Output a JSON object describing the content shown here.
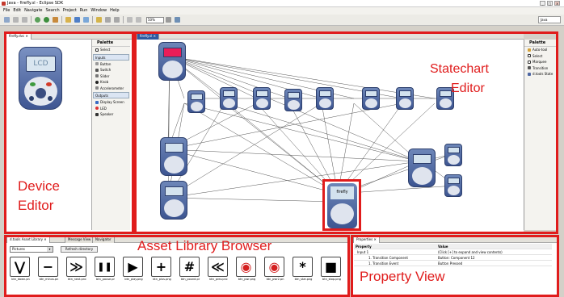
{
  "window": {
    "title": "Java - firefly.sl - Eclipse SDK",
    "minimize": "_",
    "maximize": "□",
    "close": "x"
  },
  "menu": [
    "File",
    "Edit",
    "Navigate",
    "Search",
    "Project",
    "Run",
    "Window",
    "Help"
  ],
  "toolbar": {
    "zoom": "50%",
    "perspective": "Java"
  },
  "device_editor": {
    "tab": "firefly.dvc",
    "lcd_text": "LCD",
    "palette_title": "Palette",
    "palette_items": [
      "Select",
      "Inputs",
      "Button",
      "Switch",
      "Slider",
      "Knob",
      "Accelerometer",
      "Outputs",
      "Display Screen",
      "LED",
      "Speaker"
    ],
    "label_line1": "Device",
    "label_line2": "Editor"
  },
  "statechart_editor": {
    "tab": "firefly.sl",
    "palette_title": "Palette",
    "palette_items": [
      "Auto-tool",
      "Select",
      "Marquee",
      "Transition",
      "d.tools State"
    ],
    "label_line1": "Statechart",
    "label_line2": "Editor",
    "main_state_name": "firefly"
  },
  "asset_library": {
    "tabs": [
      "d.tools Asset Library",
      "Message View",
      "Navigator"
    ],
    "folder": "Pictures",
    "refresh": "Refresh directory",
    "label": "Asset Library Browser",
    "assets": [
      {
        "glyph": "⋁",
        "name": "btn_down.pn"
      },
      {
        "glyph": "−",
        "name": "btn_minus.pn"
      },
      {
        "glyph": "≫",
        "name": "btn_next.pnc"
      },
      {
        "glyph": "❚❚",
        "name": "btn_pause.pr"
      },
      {
        "glyph": "▶",
        "name": "btn_play.png"
      },
      {
        "glyph": "+",
        "name": "btn_plus.png"
      },
      {
        "glyph": "#",
        "name": "btn_pound.pr"
      },
      {
        "glyph": "≪",
        "name": "btn_prev.pnc"
      },
      {
        "glyph": "◉",
        "name": "btn_pwr.png"
      },
      {
        "glyph": "◉",
        "name": "btn_pwr2.pn"
      },
      {
        "glyph": "*",
        "name": "btn_star.png"
      },
      {
        "glyph": "■",
        "name": "btn_stop.png"
      }
    ]
  },
  "properties": {
    "tab": "Properties",
    "col_property": "Property",
    "col_value": "Value",
    "rows": [
      {
        "property": "Input 1",
        "value": "(Click [+] to expand and view contents)"
      },
      {
        "property": "1. Transition Component",
        "value": "Button: Component 12"
      },
      {
        "property": "1. Transition Event",
        "value": "Button Pressed"
      }
    ],
    "label": "Property View"
  },
  "colors": {
    "highlight": "#e01c1c",
    "device_body": "#4d66a3",
    "screen_active": "#ea1d58"
  }
}
